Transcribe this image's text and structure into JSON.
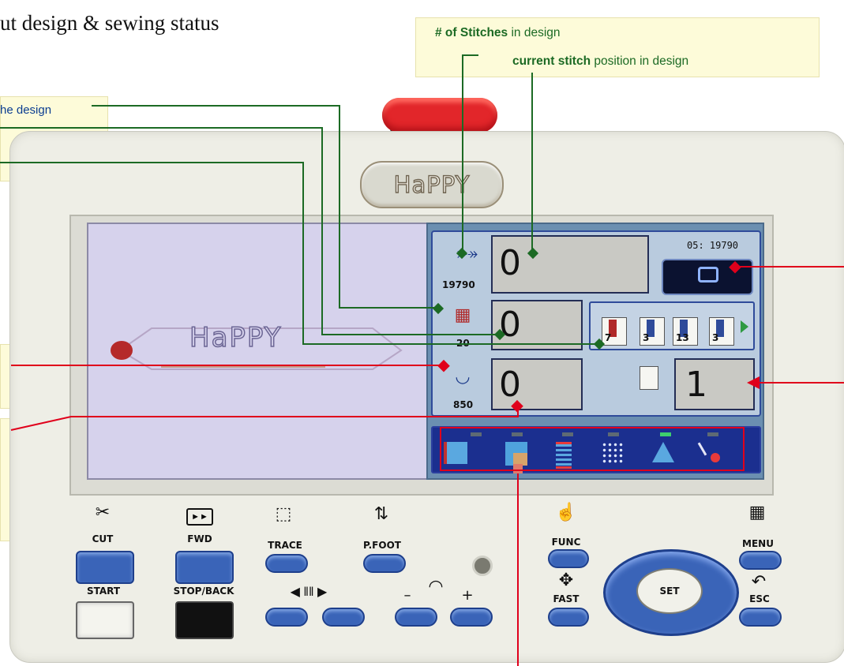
{
  "heading": "ut design & sewing status",
  "callouts": {
    "stitches_count_bold": "# of Stitches",
    "stitches_count_rest": " in design",
    "current_stitch_bold": "current stitch",
    "current_stitch_rest": " position in design",
    "left_note_1": "he design"
  },
  "machine": {
    "brand": "HaPPY",
    "screen_logo": "HaPPY",
    "stitch_total": "19790",
    "stitch_current": "0",
    "color_code": "05: 19790",
    "color_changes": "20",
    "color_value": "0",
    "speed_setting": "850",
    "speed_value": "0",
    "needle_count": "1",
    "needles": [
      "7",
      "3",
      "13",
      "3"
    ]
  },
  "buttons": {
    "cut": "CUT",
    "fwd": "FWD",
    "trace": "TRACE",
    "pfoot": "P.FOOT",
    "func": "FUNC",
    "menu": "MENU",
    "start": "START",
    "stop_back": "STOP/BACK",
    "fast": "FAST",
    "set": "SET",
    "esc": "ESC",
    "minus": "–",
    "plus": "+"
  },
  "colors": {
    "callout_green": "#1c6a24",
    "callout_red": "#e0001b",
    "callout_navy": "#0b3d91",
    "panel_blue": "#3a64b8",
    "estop_red": "#e2262a"
  }
}
